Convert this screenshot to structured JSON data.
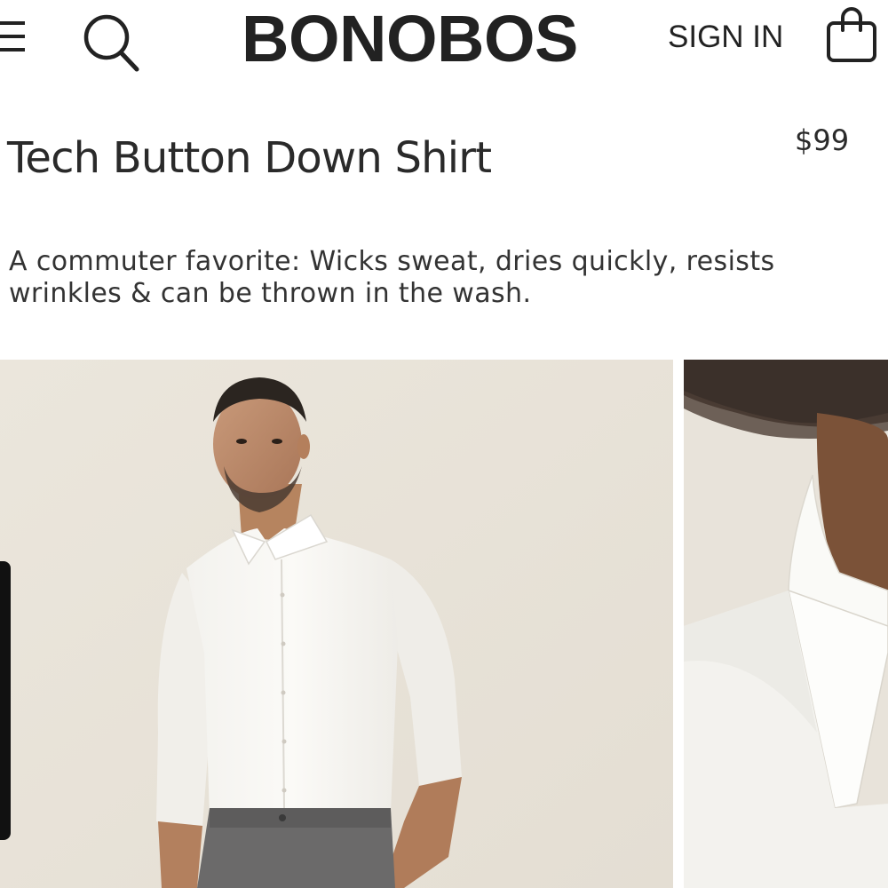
{
  "header": {
    "brand": "BONOBOS",
    "sign_in_label": "SIGN IN",
    "icons": {
      "menu": "menu-icon",
      "search": "search-icon",
      "bag": "shopping-bag-icon"
    }
  },
  "product": {
    "title": "Tech Button Down Shirt",
    "price": "$99",
    "description": "A commuter favorite: Wicks sweat, dries quickly, resists wrinkles & can be thrown in the wash."
  },
  "colors": {
    "text": "#222222",
    "background": "#ffffff",
    "photo_background": "#e9e4db"
  }
}
